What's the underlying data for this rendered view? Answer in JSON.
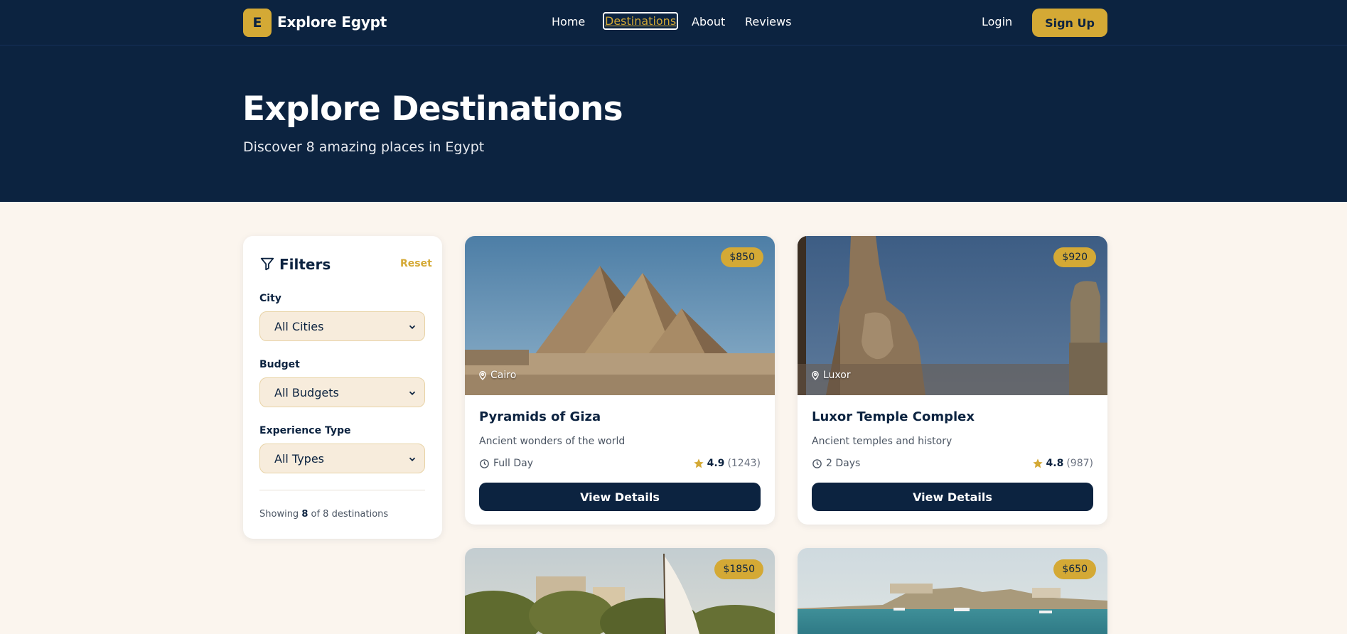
{
  "nav": {
    "logo_letter": "E",
    "brand": "Explore Egypt",
    "links": [
      {
        "label": "Home"
      },
      {
        "label": "Destinations"
      },
      {
        "label": "About"
      },
      {
        "label": "Reviews"
      }
    ],
    "login": "Login",
    "signup": "Sign Up"
  },
  "hero": {
    "title": "Explore Destinations",
    "subtitle": "Discover 8 amazing places in Egypt"
  },
  "filters": {
    "title": "Filters",
    "reset": "Reset",
    "city_label": "City",
    "city_value": "All Cities",
    "budget_label": "Budget",
    "budget_value": "All Budgets",
    "type_label": "Experience Type",
    "type_value": "All Types",
    "showing_prefix": "Showing",
    "showing_count": "8",
    "showing_suffix": "of 8 destinations"
  },
  "cards": [
    {
      "price": "$850",
      "location": "Cairo",
      "title": "Pyramids of Giza",
      "desc": "Ancient wonders of the world",
      "duration": "Full Day",
      "rating": "4.9",
      "reviews": "(1243)",
      "button": "View Details"
    },
    {
      "price": "$920",
      "location": "Luxor",
      "title": "Luxor Temple Complex",
      "desc": "Ancient temples and history",
      "duration": "2 Days",
      "rating": "4.8",
      "reviews": "(987)",
      "button": "View Details"
    },
    {
      "price": "$1850"
    },
    {
      "price": "$650"
    }
  ],
  "colors": {
    "navy": "#0c2340",
    "gold": "#d4a935",
    "cream": "#fbf5ee"
  }
}
